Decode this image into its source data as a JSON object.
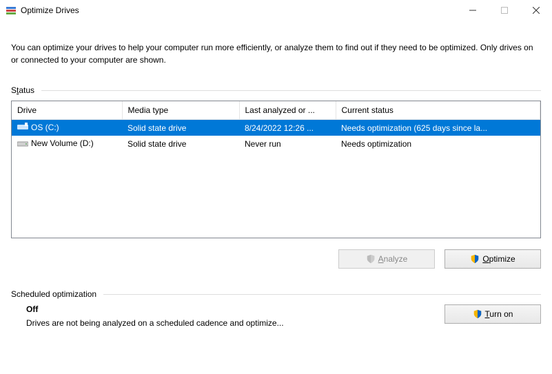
{
  "window": {
    "title": "Optimize Drives"
  },
  "description": "You can optimize your drives to help your computer run more efficiently, or analyze them to find out if they need to be optimized. Only drives on or connected to your computer are shown.",
  "status": {
    "label_pre": "S",
    "label_u": "t",
    "label_post": "atus",
    "columns": {
      "drive": "Drive",
      "media": "Media type",
      "last": "Last analyzed or ...",
      "status": "Current status"
    },
    "rows": [
      {
        "selected": true,
        "icon": "drive-os-icon",
        "drive": "OS (C:)",
        "media": "Solid state drive",
        "last": "8/24/2022 12:26 ...",
        "status": "Needs optimization (625 days since la..."
      },
      {
        "selected": false,
        "icon": "drive-icon",
        "drive": "New Volume (D:)",
        "media": "Solid state drive",
        "last": "Never run",
        "status": "Needs optimization"
      }
    ]
  },
  "buttons": {
    "analyze_u": "A",
    "analyze_rest": "nalyze",
    "optimize_u": "O",
    "optimize_rest": "ptimize",
    "turnon_u": "T",
    "turnon_rest": "urn on"
  },
  "scheduled": {
    "label": "Scheduled optimization",
    "state": "Off",
    "desc": "Drives are not being analyzed on a scheduled cadence and optimize..."
  }
}
